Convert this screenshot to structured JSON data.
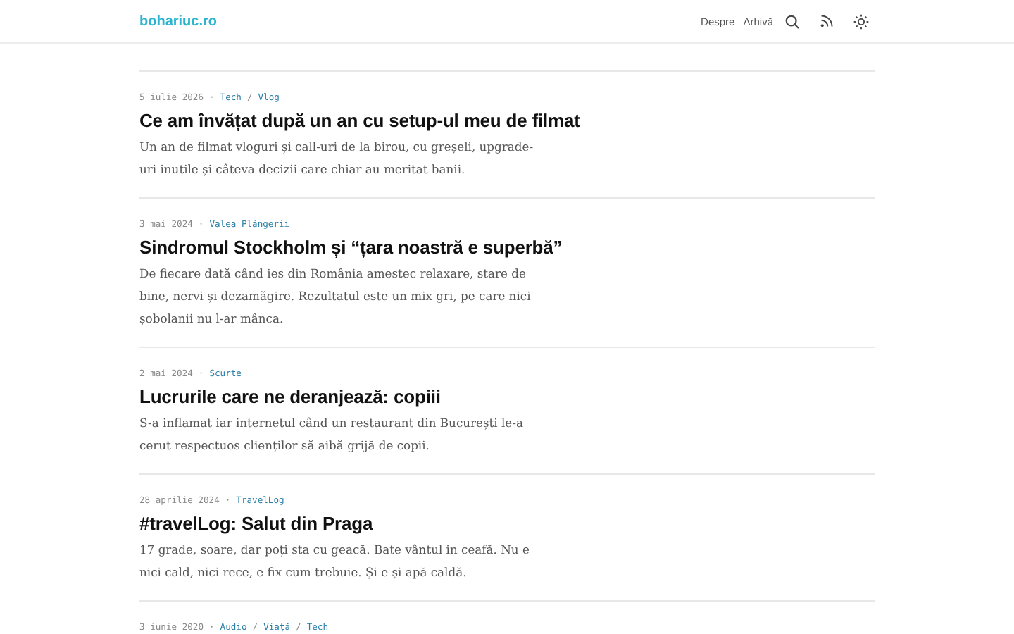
{
  "header": {
    "logo": "bohariuc.ro",
    "nav": [
      "Despre",
      "Arhivă"
    ]
  },
  "meta_separator": "·",
  "category_separator": "/",
  "posts": [
    {
      "date": "5 iulie 2026",
      "categories": [
        "Tech",
        "Vlog"
      ],
      "title": "Ce am învățat după un an cu setup-ul meu de filmat",
      "excerpt": "Un an de filmat vloguri și call-uri de la birou, cu greșeli, upgrade-uri inutile și câteva decizii care chiar au meritat banii."
    },
    {
      "date": "3 mai 2024",
      "categories": [
        "Valea Plângerii"
      ],
      "title": "Sindromul Stockholm și “țara noastră e superbă”",
      "excerpt": "De fiecare dată când ies din România amestec relaxare, stare de bine, nervi și dezamăgire. Rezultatul este un mix gri, pe care nici șobolanii nu l-ar mânca."
    },
    {
      "date": "2 mai 2024",
      "categories": [
        "Scurte"
      ],
      "title": "Lucrurile care ne deranjează: copiii",
      "excerpt": "S-a inflamat iar internetul când un restaurant din București le-a cerut respectuos clienților să aibă grijă de copii."
    },
    {
      "date": "28 aprilie 2024",
      "categories": [
        "TravelLog"
      ],
      "title": "#travelLog: Salut din Praga",
      "excerpt": "17 grade, soare, dar poți sta cu geacă. Bate vântul in ceafă. Nu e nici cald, nici rece, e fix cum trebuie. Și e și apă caldă."
    },
    {
      "date": "3 iunie 2020",
      "categories": [
        "Audio",
        "Viață",
        "Tech"
      ]
    }
  ]
}
